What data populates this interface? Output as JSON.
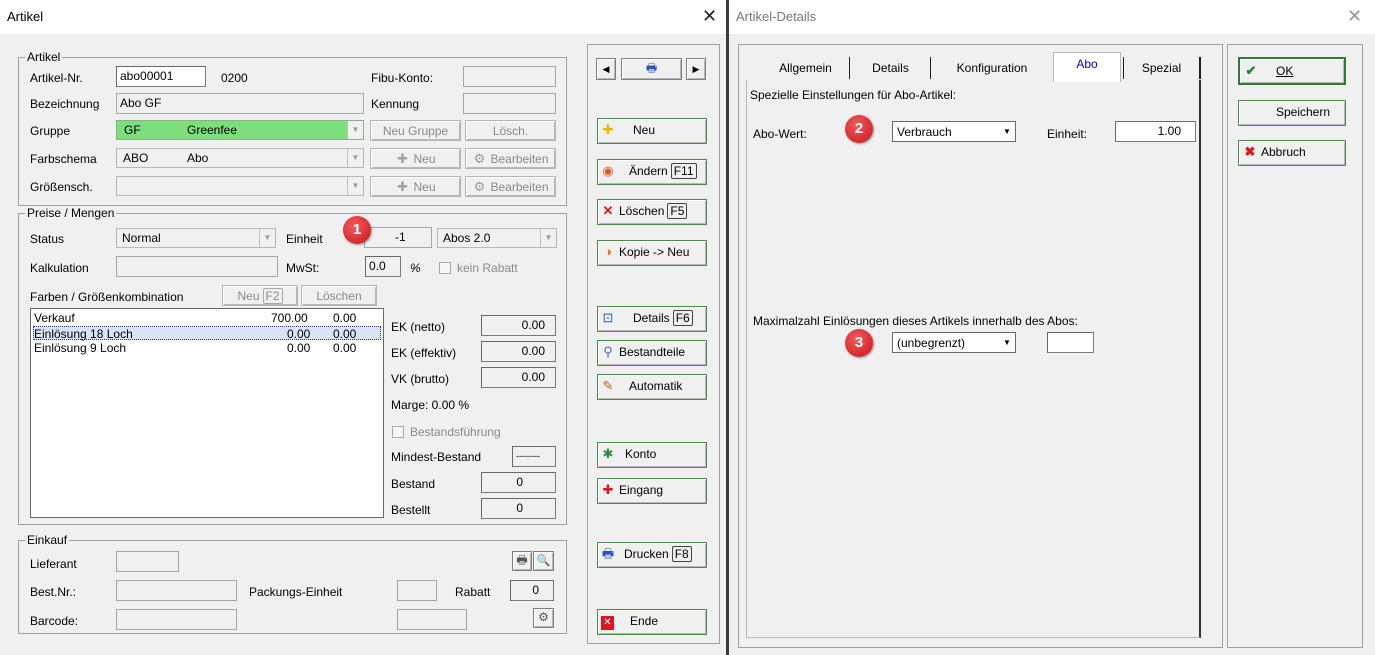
{
  "left": {
    "title": "Artikel",
    "close": "✕",
    "artikel": {
      "legend": "Artikel",
      "nr_label": "Artikel-Nr.",
      "nr_value": "abo00001",
      "nr_code": "0200",
      "fibu_label": "Fibu-Konto:",
      "bez_label": "Bezeichnung",
      "bez_value": "Abo GF",
      "kennung_label": "Kennung",
      "gruppe_label": "Gruppe",
      "gruppe_code": "GF",
      "gruppe_name": "Greenfee",
      "gruppe_neu": "Neu Gruppe",
      "gruppe_losch": "Lösch.",
      "farb_label": "Farbschema",
      "farb_code": "ABO",
      "farb_name": "Abo",
      "neu": "Neu",
      "bearbeiten": "Bearbeiten",
      "gross_label": "Größensch."
    },
    "preise": {
      "legend": "Preise / Mengen",
      "status_label": "Status",
      "status_value": "Normal",
      "einheit_label": "Einheit",
      "einheit_value": "-1",
      "einheit_combo": "Abos 2.0",
      "kalk_label": "Kalkulation",
      "mwst_label": "MwSt:",
      "mwst_value": "0.0",
      "pct": "%",
      "kein_rabatt": "kein Rabatt",
      "farben_label": "Farben / Größenkombination",
      "neu_btn": "Neu",
      "neu_key": "F2",
      "losch_btn": "Löschen",
      "rows": [
        {
          "name": "Verkauf",
          "a": "700.00",
          "b": "0.00"
        },
        {
          "name": "Einlösung 18 Loch",
          "a": "0.00",
          "b": "0.00"
        },
        {
          "name": "Einlösung 9 Loch",
          "a": "0.00",
          "b": "0.00"
        }
      ],
      "ek_netto_label": "EK (netto)",
      "ek_netto": "0.00",
      "ek_eff_label": "EK (effektiv)",
      "ek_eff": "0.00",
      "vk_label": "VK (brutto)",
      "vk": "0.00",
      "marge": "Marge: 0.00 %",
      "bestand_chk": "Bestandsführung",
      "mindest_label": "Mindest-Bestand",
      "mindest_value": "--------",
      "bestand_label": "Bestand",
      "bestand_value": "0",
      "bestellt_label": "Bestellt",
      "bestellt_value": "0"
    },
    "einkauf": {
      "legend": "Einkauf",
      "lief_label": "Lieferant",
      "bestnr_label": "Best.Nr.:",
      "pack_label": "Packungs-Einheit",
      "rabatt_label": "Rabatt",
      "rabatt_value": "0",
      "barcode_label": "Barcode:"
    },
    "side": {
      "neu": "Neu",
      "aendern": "Ändern",
      "aendern_key": "F11",
      "loeschen": "Löschen",
      "loeschen_key": "F5",
      "kopie": "Kopie -> Neu",
      "details": "Details",
      "details_key": "F6",
      "bestandteile": "Bestandteile",
      "automatik": "Automatik",
      "konto": "Konto",
      "eingang": "Eingang",
      "drucken": "Drucken",
      "drucken_key": "F8",
      "ende": "Ende"
    },
    "badge1": "1"
  },
  "right": {
    "title": "Artikel-Details",
    "close": "✕",
    "tabs": [
      "Allgemein",
      "Details",
      "Konfiguration",
      "Abo",
      "Spezial"
    ],
    "heading": "Spezielle Einstellungen für Abo-Artikel:",
    "abowert_label": "Abo-Wert:",
    "abowert_value": "Verbrauch",
    "einheit_label": "Einheit:",
    "einheit_value": "1.00",
    "max_label": "Maximalzahl Einlösungen dieses Artikels innerhalb des Abos:",
    "max_value": "(unbegrenzt)",
    "ok": "OK",
    "speichern": "Speichern",
    "abbruch": "Abbruch",
    "badge2": "2",
    "badge3": "3"
  },
  "colors": {
    "greenfee": "#7be07b",
    "selected_row": "#d9e4f5",
    "badge": "#d4161c",
    "active_tab": "#0000c8"
  }
}
